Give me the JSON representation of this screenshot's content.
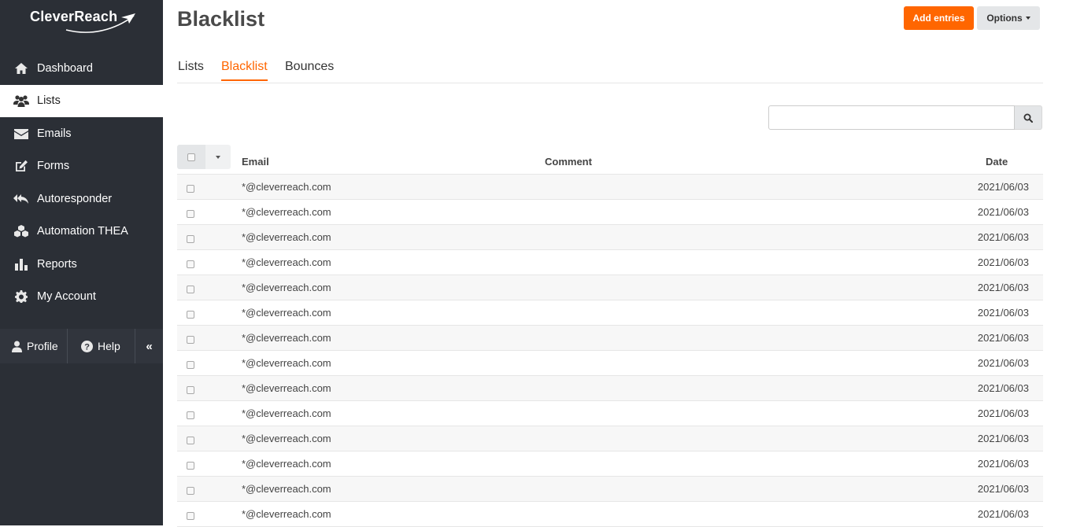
{
  "brand": {
    "name": "CleverReach"
  },
  "sidebar": {
    "items": [
      {
        "label": "Dashboard",
        "icon": "home-icon"
      },
      {
        "label": "Lists",
        "icon": "users-icon",
        "active": true
      },
      {
        "label": "Emails",
        "icon": "envelope-icon"
      },
      {
        "label": "Forms",
        "icon": "edit-icon"
      },
      {
        "label": "Autoresponder",
        "icon": "reply-all-icon"
      },
      {
        "label": "Automation THEA",
        "icon": "cubes-icon"
      },
      {
        "label": "Reports",
        "icon": "bar-chart-icon"
      },
      {
        "label": "My Account",
        "icon": "gear-icon"
      }
    ],
    "footer": {
      "profile": "Profile",
      "help": "Help",
      "collapse": "«"
    }
  },
  "header": {
    "title": "Blacklist",
    "add_button": "Add entries",
    "options_button": "Options"
  },
  "tabs": [
    {
      "label": "Lists"
    },
    {
      "label": "Blacklist",
      "active": true
    },
    {
      "label": "Bounces"
    }
  ],
  "search": {
    "placeholder": ""
  },
  "table": {
    "columns": {
      "email": "Email",
      "comment": "Comment",
      "date": "Date"
    },
    "rows": [
      {
        "email": "*@cleverreach.com",
        "comment": "",
        "date": "2021/06/03"
      },
      {
        "email": "*@cleverreach.com",
        "comment": "",
        "date": "2021/06/03"
      },
      {
        "email": "*@cleverreach.com",
        "comment": "",
        "date": "2021/06/03"
      },
      {
        "email": "*@cleverreach.com",
        "comment": "",
        "date": "2021/06/03"
      },
      {
        "email": "*@cleverreach.com",
        "comment": "",
        "date": "2021/06/03"
      },
      {
        "email": "*@cleverreach.com",
        "comment": "",
        "date": "2021/06/03"
      },
      {
        "email": "*@cleverreach.com",
        "comment": "",
        "date": "2021/06/03"
      },
      {
        "email": "*@cleverreach.com",
        "comment": "",
        "date": "2021/06/03"
      },
      {
        "email": "*@cleverreach.com",
        "comment": "",
        "date": "2021/06/03"
      },
      {
        "email": "*@cleverreach.com",
        "comment": "",
        "date": "2021/06/03"
      },
      {
        "email": "*@cleverreach.com",
        "comment": "",
        "date": "2021/06/03"
      },
      {
        "email": "*@cleverreach.com",
        "comment": "",
        "date": "2021/06/03"
      },
      {
        "email": "*@cleverreach.com",
        "comment": "",
        "date": "2021/06/03"
      },
      {
        "email": "*@cleverreach.com",
        "comment": "",
        "date": "2021/06/03"
      }
    ]
  },
  "colors": {
    "accent": "#ff6600",
    "sidebar_bg": "#2b2f36"
  }
}
